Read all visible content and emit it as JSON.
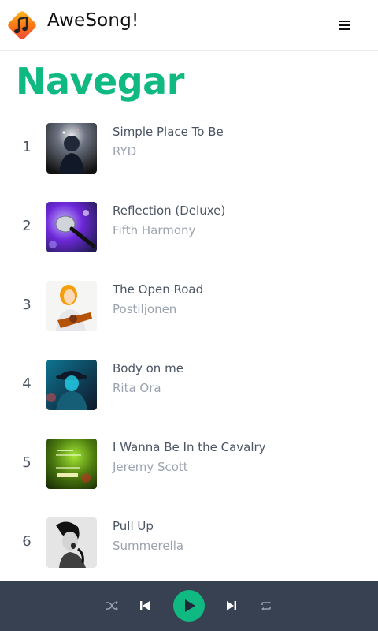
{
  "header": {
    "app_name": "AweSong!",
    "logo_icon": "music-note-icon",
    "menu_icon": "hamburger-menu-icon"
  },
  "page": {
    "title": "Navegar"
  },
  "tracks": [
    {
      "number": "1",
      "title": "Simple Place To Be",
      "artist": "RYD"
    },
    {
      "number": "2",
      "title": "Reflection (Deluxe)",
      "artist": "Fifth Harmony"
    },
    {
      "number": "3",
      "title": "The Open Road",
      "artist": "Postiljonen"
    },
    {
      "number": "4",
      "title": "Body on me",
      "artist": "Rita Ora"
    },
    {
      "number": "5",
      "title": "I Wanna Be In the Cavalry",
      "artist": "Jeremy Scott"
    },
    {
      "number": "6",
      "title": "Pull Up",
      "artist": "Summerella"
    }
  ],
  "player": {
    "controls": [
      "shuffle-icon",
      "previous-icon",
      "play-icon",
      "next-icon",
      "repeat-icon"
    ]
  },
  "colors": {
    "accent": "#10b981",
    "player_bg": "#374151",
    "title_text": "#4b5563",
    "artist_text": "#9ca3af"
  }
}
